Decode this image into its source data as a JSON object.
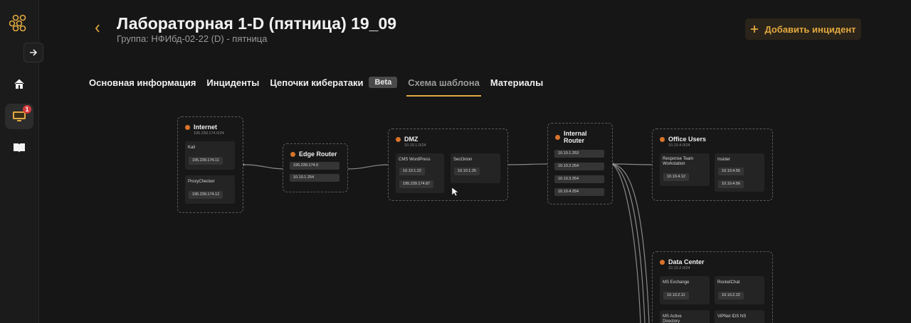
{
  "app": {
    "title": "Лабораторная 1-D (пятница) 19_09",
    "subtitle": "Группа: НФИбд-02-22 (D) - пятница",
    "add_button": "Добавить инцидент",
    "notification_count": "1"
  },
  "tabs": [
    {
      "label": "Основная информация"
    },
    {
      "label": "Инциденты"
    },
    {
      "label": "Цепочки кибератаки",
      "badge": "Beta"
    },
    {
      "label": "Схема шаблона",
      "active": true
    },
    {
      "label": "Материалы"
    }
  ],
  "diagram": {
    "internet": {
      "name": "Internet",
      "subnet": "195.239.174.0/24",
      "hosts": [
        {
          "name": "Kali",
          "ips": [
            "195.239.174.11"
          ]
        },
        {
          "name": "ProxyChecker",
          "ips": [
            "195.239.174.12"
          ]
        }
      ]
    },
    "edge_router": {
      "name": "Edge Router",
      "ips": [
        "195.239.174.0",
        "10.10.1.254"
      ]
    },
    "dmz": {
      "name": "DMZ",
      "subnet": "10.10.1.0/24",
      "hosts": [
        {
          "name": "CMS WordPress",
          "ips": [
            "10.10.1.22",
            "195.239.174.87"
          ]
        },
        {
          "name": "SecOnion",
          "ips": [
            "10.10.1.25"
          ]
        }
      ]
    },
    "internal_router": {
      "name": "Internal Router",
      "ips": [
        "10.10.1.253",
        "10.10.2.254",
        "10.10.3.254",
        "10.10.4.254"
      ]
    },
    "office_users": {
      "name": "Office Users",
      "subnet": "10.10.4.0/24",
      "hosts": [
        {
          "name": "Response Team Workstation",
          "ips": [
            "10.10.4.12"
          ]
        },
        {
          "name": "Insider",
          "ips": [
            "10.10.4.55",
            "10.10.4.56"
          ]
        }
      ]
    },
    "data_center": {
      "name": "Data Center",
      "subnet": "10.10.2.0/24",
      "hosts": [
        {
          "name": "MS Exchange",
          "ips": [
            "10.10.2.11"
          ]
        },
        {
          "name": "RocketChat",
          "ips": [
            "10.10.2.22"
          ]
        },
        {
          "name": "MS Active Directory",
          "ips": []
        },
        {
          "name": "ViPNet IDS NS",
          "ips": []
        }
      ]
    }
  }
}
